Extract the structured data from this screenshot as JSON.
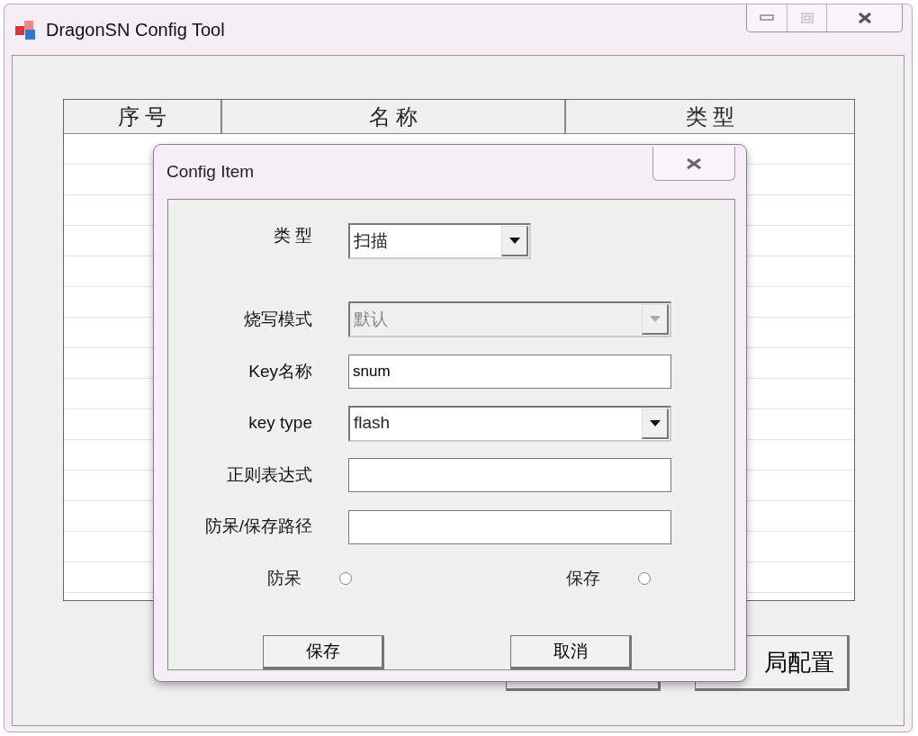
{
  "window": {
    "title": "DragonSN Config Tool"
  },
  "table": {
    "columns": [
      "序 号",
      "名 称",
      "类 型"
    ]
  },
  "main_buttons": [
    {
      "kind": "covered"
    },
    {
      "kind": "text",
      "label": "局配置"
    }
  ],
  "dialog": {
    "title": "Config Item",
    "fields": [
      {
        "kind": "select",
        "label": "类 型",
        "value": "扫描",
        "disabled": false,
        "wide": false
      },
      {
        "kind": "select",
        "label": "烧写模式",
        "value": "默认",
        "disabled": true,
        "wide": true
      },
      {
        "kind": "input",
        "label": "Key名称",
        "value": "snum"
      },
      {
        "kind": "select",
        "label": "key type",
        "value": "flash",
        "disabled": false,
        "wide": true
      },
      {
        "kind": "input",
        "label": "正则表达式"
      },
      {
        "kind": "input",
        "label": "防呆/保存路径"
      }
    ],
    "radios": [
      {
        "label": "防呆",
        "selected": false
      },
      {
        "label": "保存",
        "selected": false
      }
    ],
    "buttons": [
      "保存",
      "取消"
    ]
  }
}
